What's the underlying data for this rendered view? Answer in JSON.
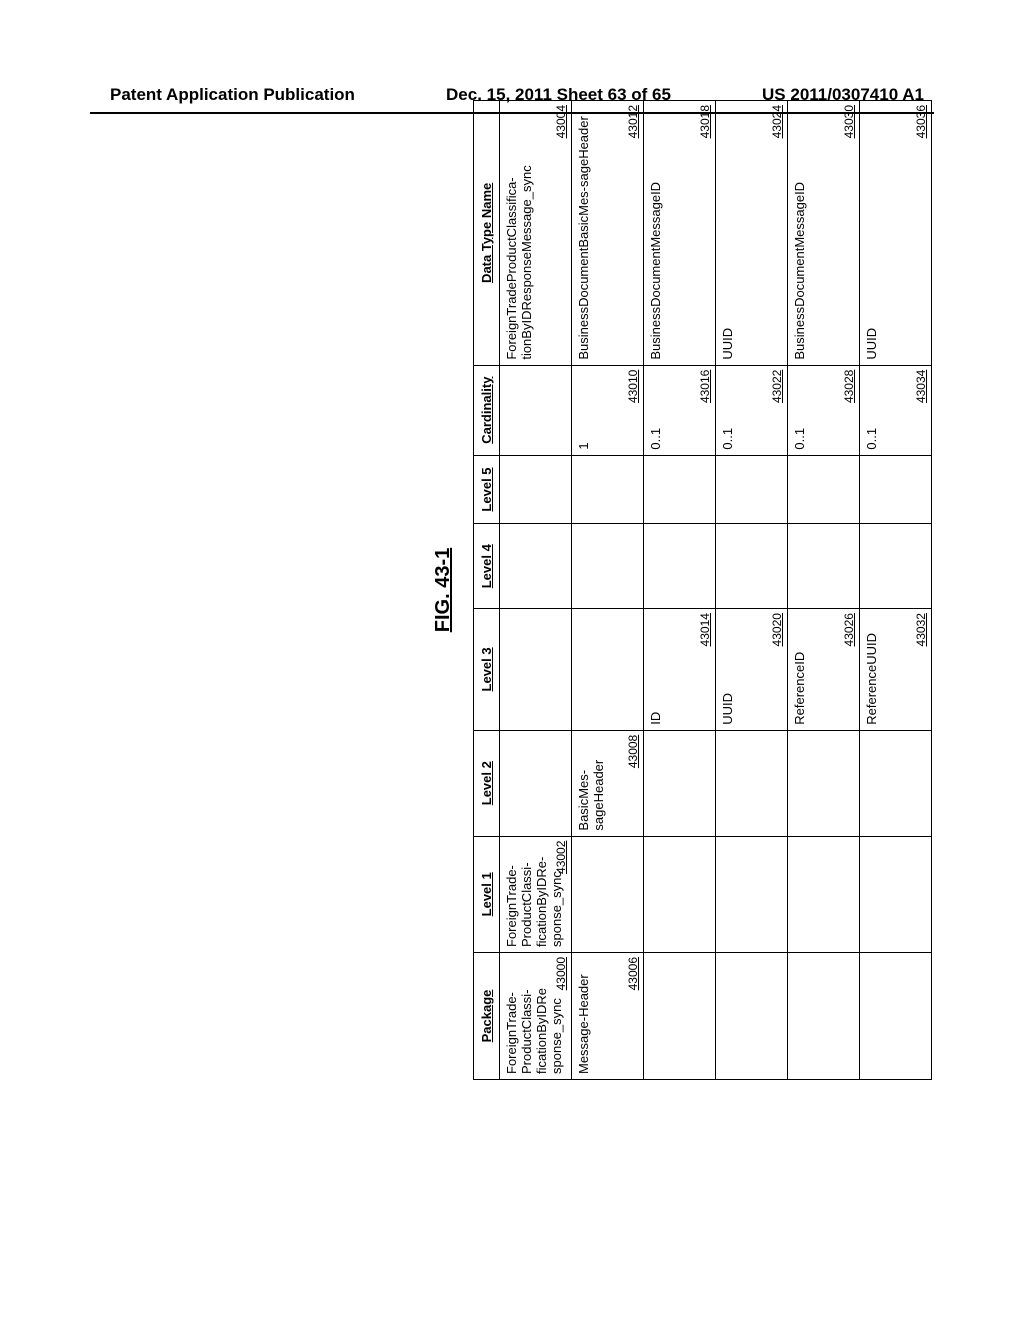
{
  "header": {
    "left": "Patent Application Publication",
    "center": "Dec. 15, 2011  Sheet 63 of 65",
    "right": "US 2011/0307410 A1"
  },
  "figure": {
    "title": "FIG. 43-1"
  },
  "columns": [
    "Package",
    "Level 1",
    "Level 2",
    "Level 3",
    "Level 4",
    "Level 5",
    "Cardinality",
    "Data Type Name"
  ],
  "rows": [
    {
      "package": "ForeignTrade-ProductClassi-ficationByIDRe sponse_sync",
      "package_ref": "43000",
      "level1": "ForeignTrade-ProductClassi-ficationByIDRe-sponse_sync",
      "level1_ref": "43002",
      "level2": "",
      "level2_ref": "",
      "level3": "",
      "level3_ref": "",
      "level4": "",
      "level5": "",
      "card": "",
      "card_ref": "",
      "dtn": "ForeignTradeProductClassifica-tionByIDResponseMessage_sync",
      "dtn_ref": "43004"
    },
    {
      "package": "Message-Header",
      "package_ref": "43006",
      "level1": "",
      "level1_ref": "",
      "level2": "BasicMes-sageHeader",
      "level2_ref": "43008",
      "level3": "",
      "level3_ref": "",
      "level4": "",
      "level5": "",
      "card": "1",
      "card_ref": "43010",
      "dtn": "BusinessDocumentBasicMes-sageHeader",
      "dtn_ref": "43012"
    },
    {
      "package": "",
      "package_ref": "",
      "level1": "",
      "level1_ref": "",
      "level2": "",
      "level2_ref": "",
      "level3": "ID",
      "level3_ref": "43014",
      "level4": "",
      "level5": "",
      "card": "0..1",
      "card_ref": "43016",
      "dtn": "BusinessDocumentMessageID",
      "dtn_ref": "43018"
    },
    {
      "package": "",
      "package_ref": "",
      "level1": "",
      "level1_ref": "",
      "level2": "",
      "level2_ref": "",
      "level3": "UUID",
      "level3_ref": "43020",
      "level4": "",
      "level5": "",
      "card": "0..1",
      "card_ref": "43022",
      "dtn": "UUID",
      "dtn_ref": "43024"
    },
    {
      "package": "",
      "package_ref": "",
      "level1": "",
      "level1_ref": "",
      "level2": "",
      "level2_ref": "",
      "level3": "ReferenceID",
      "level3_ref": "43026",
      "level4": "",
      "level5": "",
      "card": "0..1",
      "card_ref": "43028",
      "dtn": "BusinessDocumentMessageID",
      "dtn_ref": "43030"
    },
    {
      "package": "",
      "package_ref": "",
      "level1": "",
      "level1_ref": "",
      "level2": "",
      "level2_ref": "",
      "level3": "ReferenceUUID",
      "level3_ref": "43032",
      "level4": "",
      "level5": "",
      "card": "0..1",
      "card_ref": "43034",
      "dtn": "UUID",
      "dtn_ref": "43036"
    }
  ]
}
